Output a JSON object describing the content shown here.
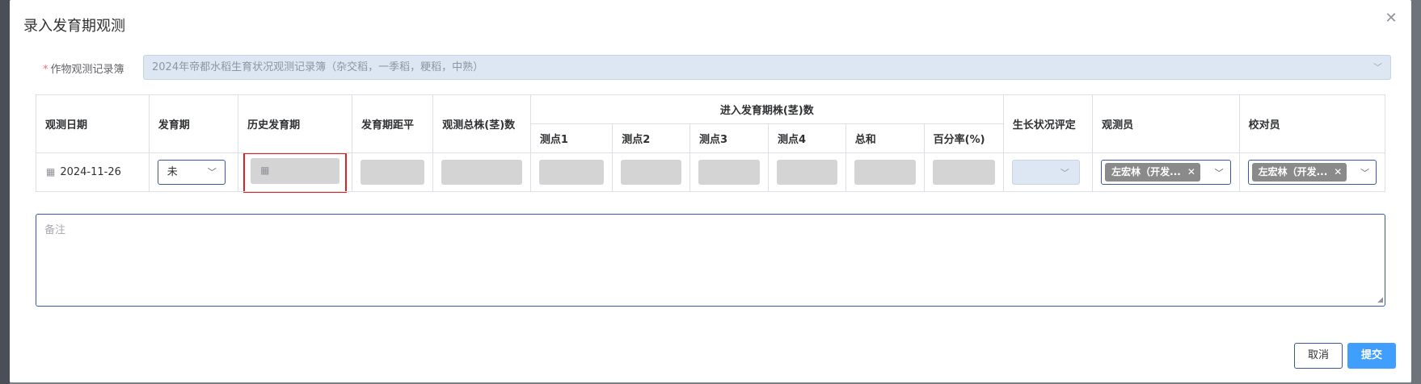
{
  "dialog": {
    "title": "录入发育期观测",
    "close_icon": "close-icon"
  },
  "record_book": {
    "required_mark": "*",
    "label": "作物观测记录簿",
    "value": "2024年帝都水稻生育状况观测记录簿（杂交稻，一季稻，粳稻，中熟）"
  },
  "table": {
    "headers": {
      "date": "观测日期",
      "stage": "发育期",
      "history_stage": "历史发育期",
      "stage_distance": "发育期距平",
      "total_plants": "观测总株(茎)数",
      "entered_group": "进入发育期株(茎)数",
      "point1": "测点1",
      "point2": "测点2",
      "point3": "测点3",
      "point4": "测点4",
      "sum": "总和",
      "percent": "百分率(%)",
      "growth_eval": "生长状况评定",
      "observer": "观测员",
      "checker": "校对员"
    },
    "row": {
      "date": "2024-11-26",
      "stage": "未",
      "observer_tag": "左宏林（开发...",
      "checker_tag": "左宏林（开发..."
    }
  },
  "remark": {
    "placeholder": "备注"
  },
  "footer": {
    "cancel": "取消",
    "submit": "提交"
  },
  "colors": {
    "primary": "#409eff",
    "highlight_border": "#e02020",
    "disabled_fill": "#d4d4d4",
    "readonly_select": "#dde6f3"
  }
}
